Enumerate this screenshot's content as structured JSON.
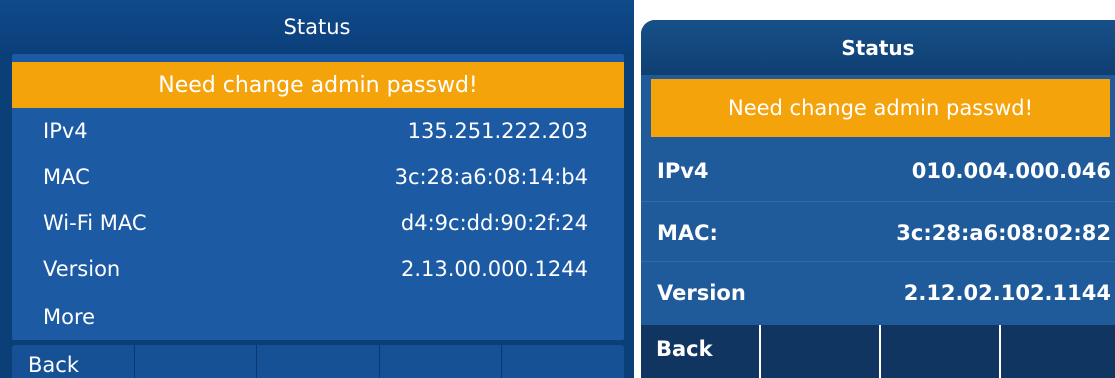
{
  "left_screen": {
    "title": "Status",
    "warning": "Need change admin passwd!",
    "rows": [
      {
        "label": "IPv4",
        "value": "135.251.222.203"
      },
      {
        "label": "MAC",
        "value": "3c:28:a6:08:14:b4"
      },
      {
        "label": "Wi-Fi MAC",
        "value": "d4:9c:dd:90:2f:24"
      },
      {
        "label": "Version",
        "value": "2.13.00.000.1244"
      },
      {
        "label": "More",
        "value": ""
      }
    ],
    "softkeys": [
      "Back",
      "",
      "",
      "",
      ""
    ]
  },
  "right_screen": {
    "title": "Status",
    "warning": "Need change admin passwd!",
    "rows": [
      {
        "label": "IPv4",
        "value": "010.004.000.046"
      },
      {
        "label": "MAC:",
        "value": "3c:28:a6:08:02:82"
      },
      {
        "label": "Version",
        "value": "2.12.02.102.1144"
      }
    ],
    "softkeys": [
      "Back",
      "",
      "",
      ""
    ]
  },
  "colors": {
    "background": "#0a3f78",
    "panel": "#1c5aa4",
    "warning_banner": "#f5a30b",
    "text": "#ffffff"
  }
}
